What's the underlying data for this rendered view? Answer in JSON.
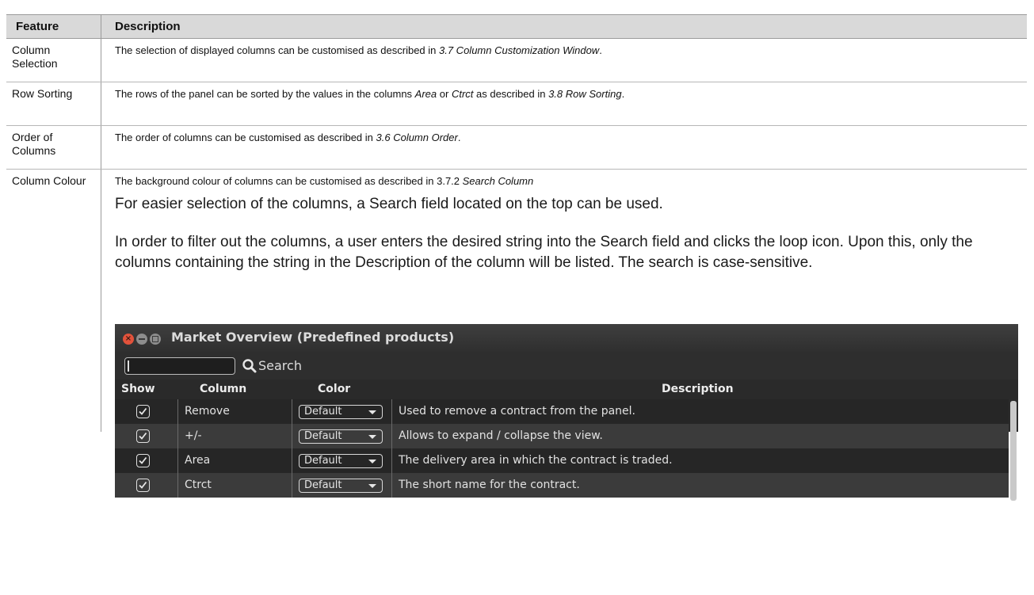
{
  "table": {
    "header": {
      "feature": "Feature",
      "description": "Description"
    },
    "rows": [
      {
        "feature": "Column Selection",
        "text": "The selection of displayed columns can be customised as described in ",
        "ref": "3.7 Column Customization Window",
        "tail": "."
      },
      {
        "feature": "Row Sorting",
        "text1": "The rows of the panel can be sorted by the values in the columns ",
        "em1": "Area",
        "text2": " or ",
        "em2": "Ctrct",
        "text3": " as described in ",
        "em3": "3.8 Row Sorting",
        "tail": "."
      },
      {
        "feature": "Order of Columns",
        "text": "The order of columns can be customised as described in ",
        "ref": "3.6 Column Order",
        "tail": "."
      },
      {
        "feature": "Column Colour",
        "text": "The background colour of columns can be customised as described in 3.7.2 ",
        "ref": "Search Column",
        "para1": "For easier selection of the columns, a Search field located on the top can be used.",
        "para2": "In order to filter out the columns, a user enters the desired string into the Search field and clicks the loop icon. Upon this, only the columns containing the string in the Description of the column will be listed. The search is case-sensitive."
      }
    ]
  },
  "window": {
    "title": "Market Overview (Predefined products)",
    "search_value": "",
    "search_label": "Search",
    "search_icon": "search-icon",
    "columns": {
      "show": "Show",
      "column": "Column",
      "color": "Color",
      "description": "Description"
    },
    "rows": [
      {
        "checked": true,
        "column": "Remove",
        "color": "Default",
        "description": "Used to remove a contract from the panel."
      },
      {
        "checked": true,
        "column": "+/-",
        "color": "Default",
        "description": "Allows to expand / collapse the view."
      },
      {
        "checked": true,
        "column": "Area",
        "color": "Default",
        "description": "The delivery area in which the contract is traded."
      },
      {
        "checked": true,
        "column": "Ctrct",
        "color": "Default",
        "description": "The short name for the contract."
      }
    ]
  }
}
